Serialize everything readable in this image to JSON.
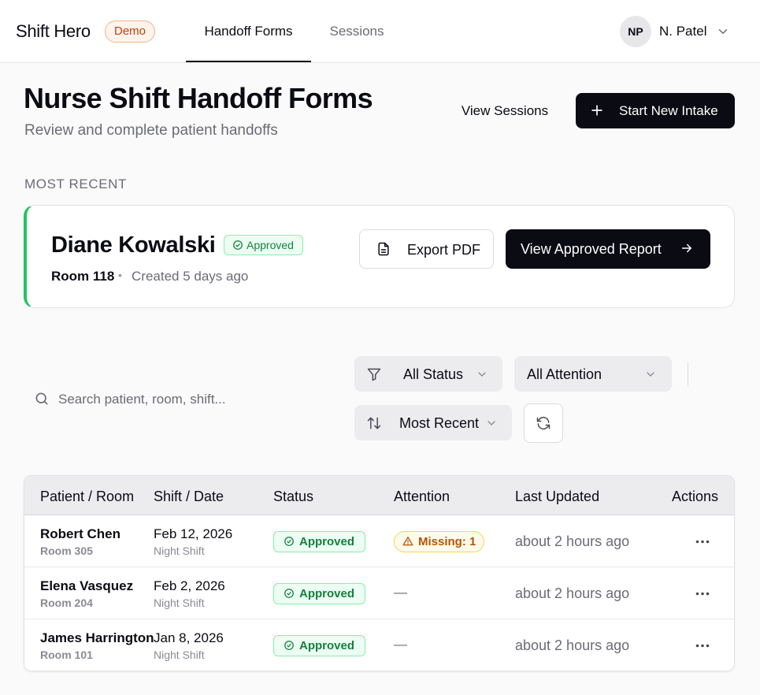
{
  "brand": {
    "name": "Shift Hero",
    "badge": "Demo"
  },
  "nav": {
    "tabs": [
      {
        "label": "Handoff Forms",
        "active": true
      },
      {
        "label": "Sessions",
        "active": false
      }
    ]
  },
  "user": {
    "initials": "NP",
    "name": "N. Patel",
    "chevron_icon": "chevron-down-icon"
  },
  "header": {
    "title": "Nurse Shift Handoff Forms",
    "subtitle": "Review and complete patient handoffs",
    "view_sessions_label": "View Sessions",
    "start_intake_label": "Start New Intake",
    "start_intake_icon": "plus-icon"
  },
  "most_recent": {
    "section_label": "MOST RECENT",
    "patient_name": "Diane Kowalski",
    "status": "Approved",
    "room": "Room 118",
    "separator": "•",
    "created": "Created 5 days ago",
    "export_label": "Export PDF",
    "export_icon": "file-icon",
    "view_report_label": "View Approved Report",
    "view_report_icon": "arrow-right-icon",
    "accent_color": "#22c55e"
  },
  "filters": {
    "search_placeholder": "Search patient, room, shift...",
    "search_value": "",
    "status_value": "All Status",
    "attention_value": "All Attention",
    "sort_value": "Most Recent"
  },
  "table": {
    "columns": {
      "patient": "Patient / Room",
      "shift": "Shift / Date",
      "status": "Status",
      "attention": "Attention",
      "updated": "Last Updated",
      "actions": "Actions"
    },
    "rows": [
      {
        "name": "Robert Chen",
        "room": "Room 305",
        "date": "Feb 12, 2026",
        "shift": "Night Shift",
        "status": "Approved",
        "attention": "Missing: 1",
        "updated": "about 2 hours ago"
      },
      {
        "name": "Elena Vasquez",
        "room": "Room 204",
        "date": "Feb 2, 2026",
        "shift": "Night Shift",
        "status": "Approved",
        "attention": "—",
        "updated": "about 2 hours ago"
      },
      {
        "name": "James Harrington",
        "room": "Room 101",
        "date": "Jan 8, 2026",
        "shift": "Night Shift",
        "status": "Approved",
        "attention": "—",
        "updated": "about 2 hours ago"
      }
    ]
  },
  "colors": {
    "primary": "#0b0b14",
    "approved_green": "#15803d",
    "warning_amber": "#b45309",
    "demo_orange": "#c2410c"
  }
}
